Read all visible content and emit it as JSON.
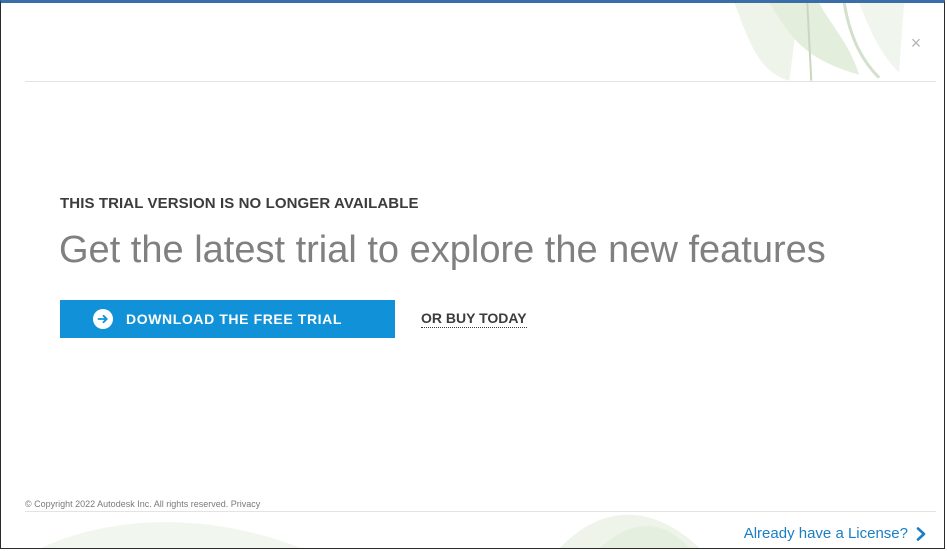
{
  "dialog": {
    "close_symbol": "×",
    "notice": "THIS TRIAL VERSION IS NO LONGER AVAILABLE",
    "headline": "Get the latest trial to explore the new features",
    "download_button_label": "DOWNLOAD THE FREE TRIAL",
    "download_icon": "arrow-circle-icon",
    "buy_link_label": "OR BUY TODAY",
    "copyright_text": "© Copyright 2022 Autodesk Inc. All rights reserved.",
    "privacy_link": "Privacy",
    "license_link_label": "Already have a License?",
    "license_icon": "chevron-right-icon"
  },
  "colors": {
    "accent": "#1192d8",
    "link": "#1a7ec4",
    "title_bar": "#3a6ea8",
    "headline": "#808080",
    "text_dark": "#3c3c3c"
  }
}
